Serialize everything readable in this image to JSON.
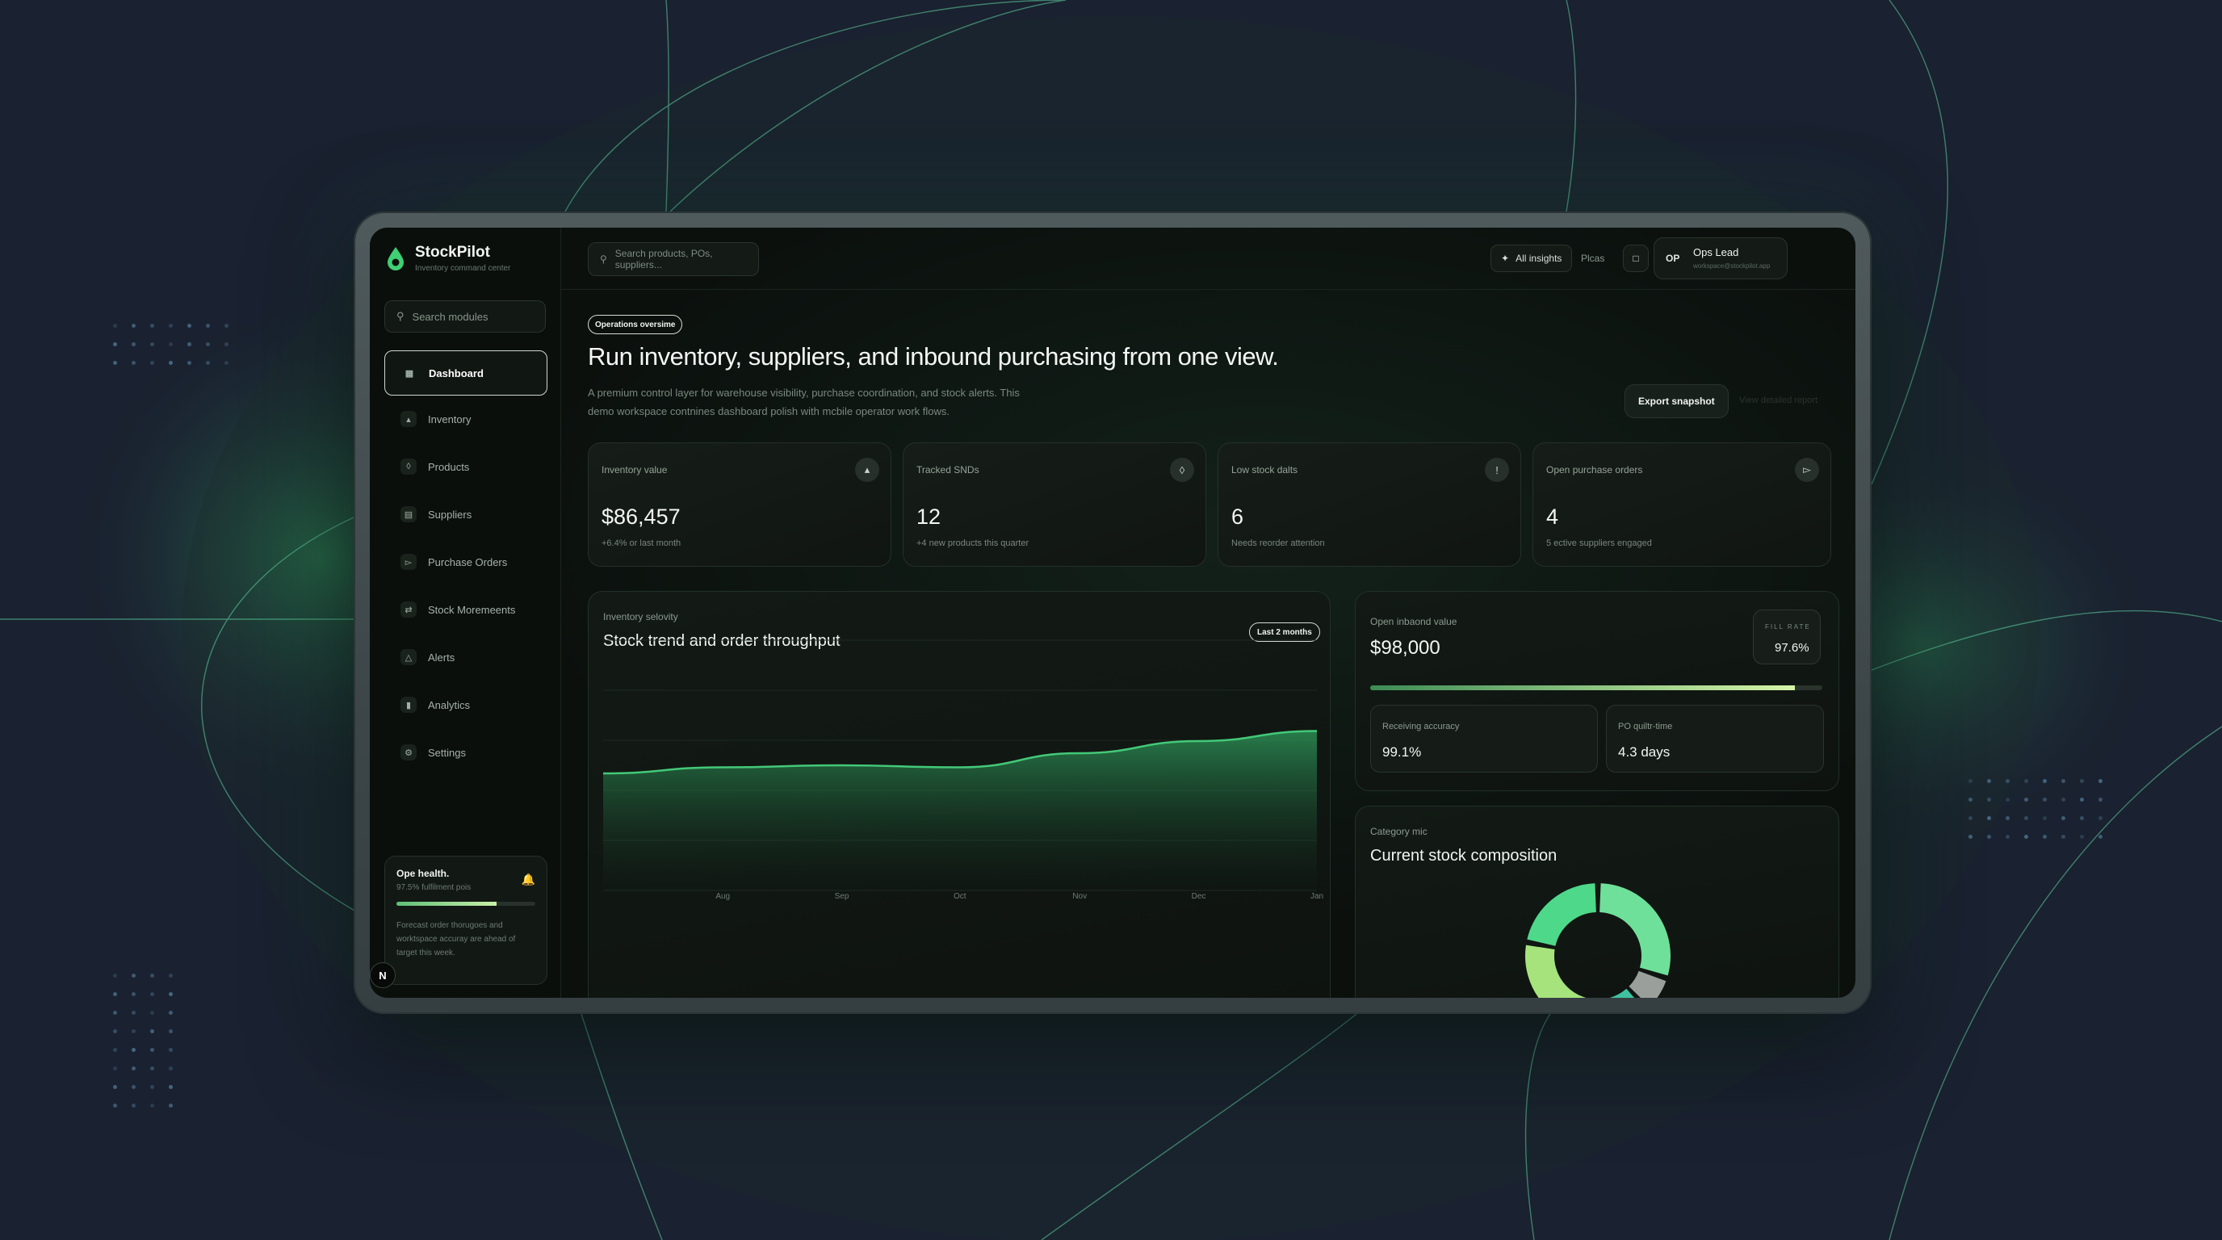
{
  "brand": {
    "name": "StockPilot",
    "subtitle": "Inventory command center",
    "accent": "#4fd17a"
  },
  "sidebar": {
    "search_placeholder": "Search modules",
    "items": [
      {
        "label": "Dashboard",
        "icon": "grid-icon",
        "active": true
      },
      {
        "label": "Inventory",
        "icon": "boxes-icon"
      },
      {
        "label": "Products",
        "icon": "package-icon"
      },
      {
        "label": "Suppliers",
        "icon": "building-icon"
      },
      {
        "label": "Purchase Orders",
        "icon": "cart-icon"
      },
      {
        "label": "Stock Moremeents",
        "icon": "shuffle-icon"
      },
      {
        "label": "Alerts",
        "icon": "alert-triangle-icon"
      },
      {
        "label": "Analytics",
        "icon": "bar-chart-icon"
      },
      {
        "label": "Settings",
        "icon": "gear-icon"
      }
    ],
    "health": {
      "title": "Ope health.",
      "subtitle": "97.5% fulfilment pois",
      "progress": 0.72,
      "text": "Forecast order thorugoes and worktspace accuray are ahead of target this week."
    },
    "avatar_letter": "N"
  },
  "topbar": {
    "search_placeholder": "Search products, POs, suppliers...",
    "insights_label": "All insights",
    "plans_label": "Plcas",
    "user": {
      "initials": "OP",
      "name": "Ops Lead",
      "email": "workspace@stockpilot.app"
    }
  },
  "hero": {
    "badge": "Operations oversime",
    "title": "Run inventory, suppliers, and inbound purchasing from one view.",
    "description": "A premium control layer for warehouse visibility, purchase coordination, and stock alerts. This demo workspace contnines dashboard polish with mcbile operator work flows.",
    "export_label": "Export snapshot",
    "secondary_label": "View detailed report"
  },
  "stats": [
    {
      "label": "Inventory value",
      "value": "$86,457",
      "sub": "+6.4% or last month",
      "icon": "boxes-icon"
    },
    {
      "label": "Tracked SNDs",
      "value": "12",
      "sub": "+4 new products this quarter",
      "icon": "package-icon"
    },
    {
      "label": "Low stock dalts",
      "value": "6",
      "sub": "Needs reorder attention",
      "icon": "alert-icon"
    },
    {
      "label": "Open purchase orders",
      "value": "4",
      "sub": "5 ective suppliers engaged",
      "icon": "cart-icon"
    }
  ],
  "velocity": {
    "label": "Inventory selovity",
    "title": "Stock trend and order throughput",
    "range": "Last 2 months"
  },
  "chart_data": {
    "type": "area",
    "x": [
      "Aug",
      "Sep",
      "Oct",
      "Nov",
      "Dec",
      "Jan"
    ],
    "series": [
      {
        "values": [
          58,
          61,
          62,
          61,
          68,
          74,
          79
        ]
      }
    ],
    "ylim": [
      0,
      100
    ],
    "grid": true,
    "color": "#43c978"
  },
  "inbound": {
    "label": "Open inbaond value",
    "value": "$98,000",
    "fill_rate_label": "FILL RATE",
    "fill_rate_value": "97.6%",
    "progress": 0.94,
    "receiving_label": "Receiving accuracy",
    "receiving_value": "99.1%",
    "quote_label": "PO quiltr-time",
    "quote_value": "4.3 days"
  },
  "composition": {
    "label": "Category mic",
    "title": "Current stock composition",
    "slices": [
      {
        "value": 30,
        "color": "#6fe09a"
      },
      {
        "value": 8,
        "color": "#9a9f9c"
      },
      {
        "value": 10,
        "color": "#3fc2a0"
      },
      {
        "value": 30,
        "color": "#a6e37d"
      },
      {
        "value": 22,
        "color": "#4ed98a"
      }
    ]
  }
}
